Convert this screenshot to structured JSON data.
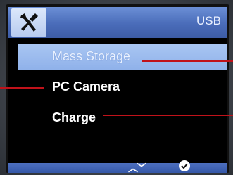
{
  "header": {
    "icon": "tools-icon",
    "title": "USB"
  },
  "menu": {
    "items": [
      {
        "label": "Mass Storage",
        "selected": true
      },
      {
        "label": "PC Camera",
        "selected": false
      },
      {
        "label": "Charge",
        "selected": false
      }
    ]
  },
  "footer": {
    "nav_icon": "up-down-arrows-icon",
    "confirm_icon": "checkmark-icon"
  },
  "colors": {
    "header_blue": "#4a6cb9",
    "selection_blue": "#9db9ee",
    "pointer_red": "#c0121a"
  }
}
